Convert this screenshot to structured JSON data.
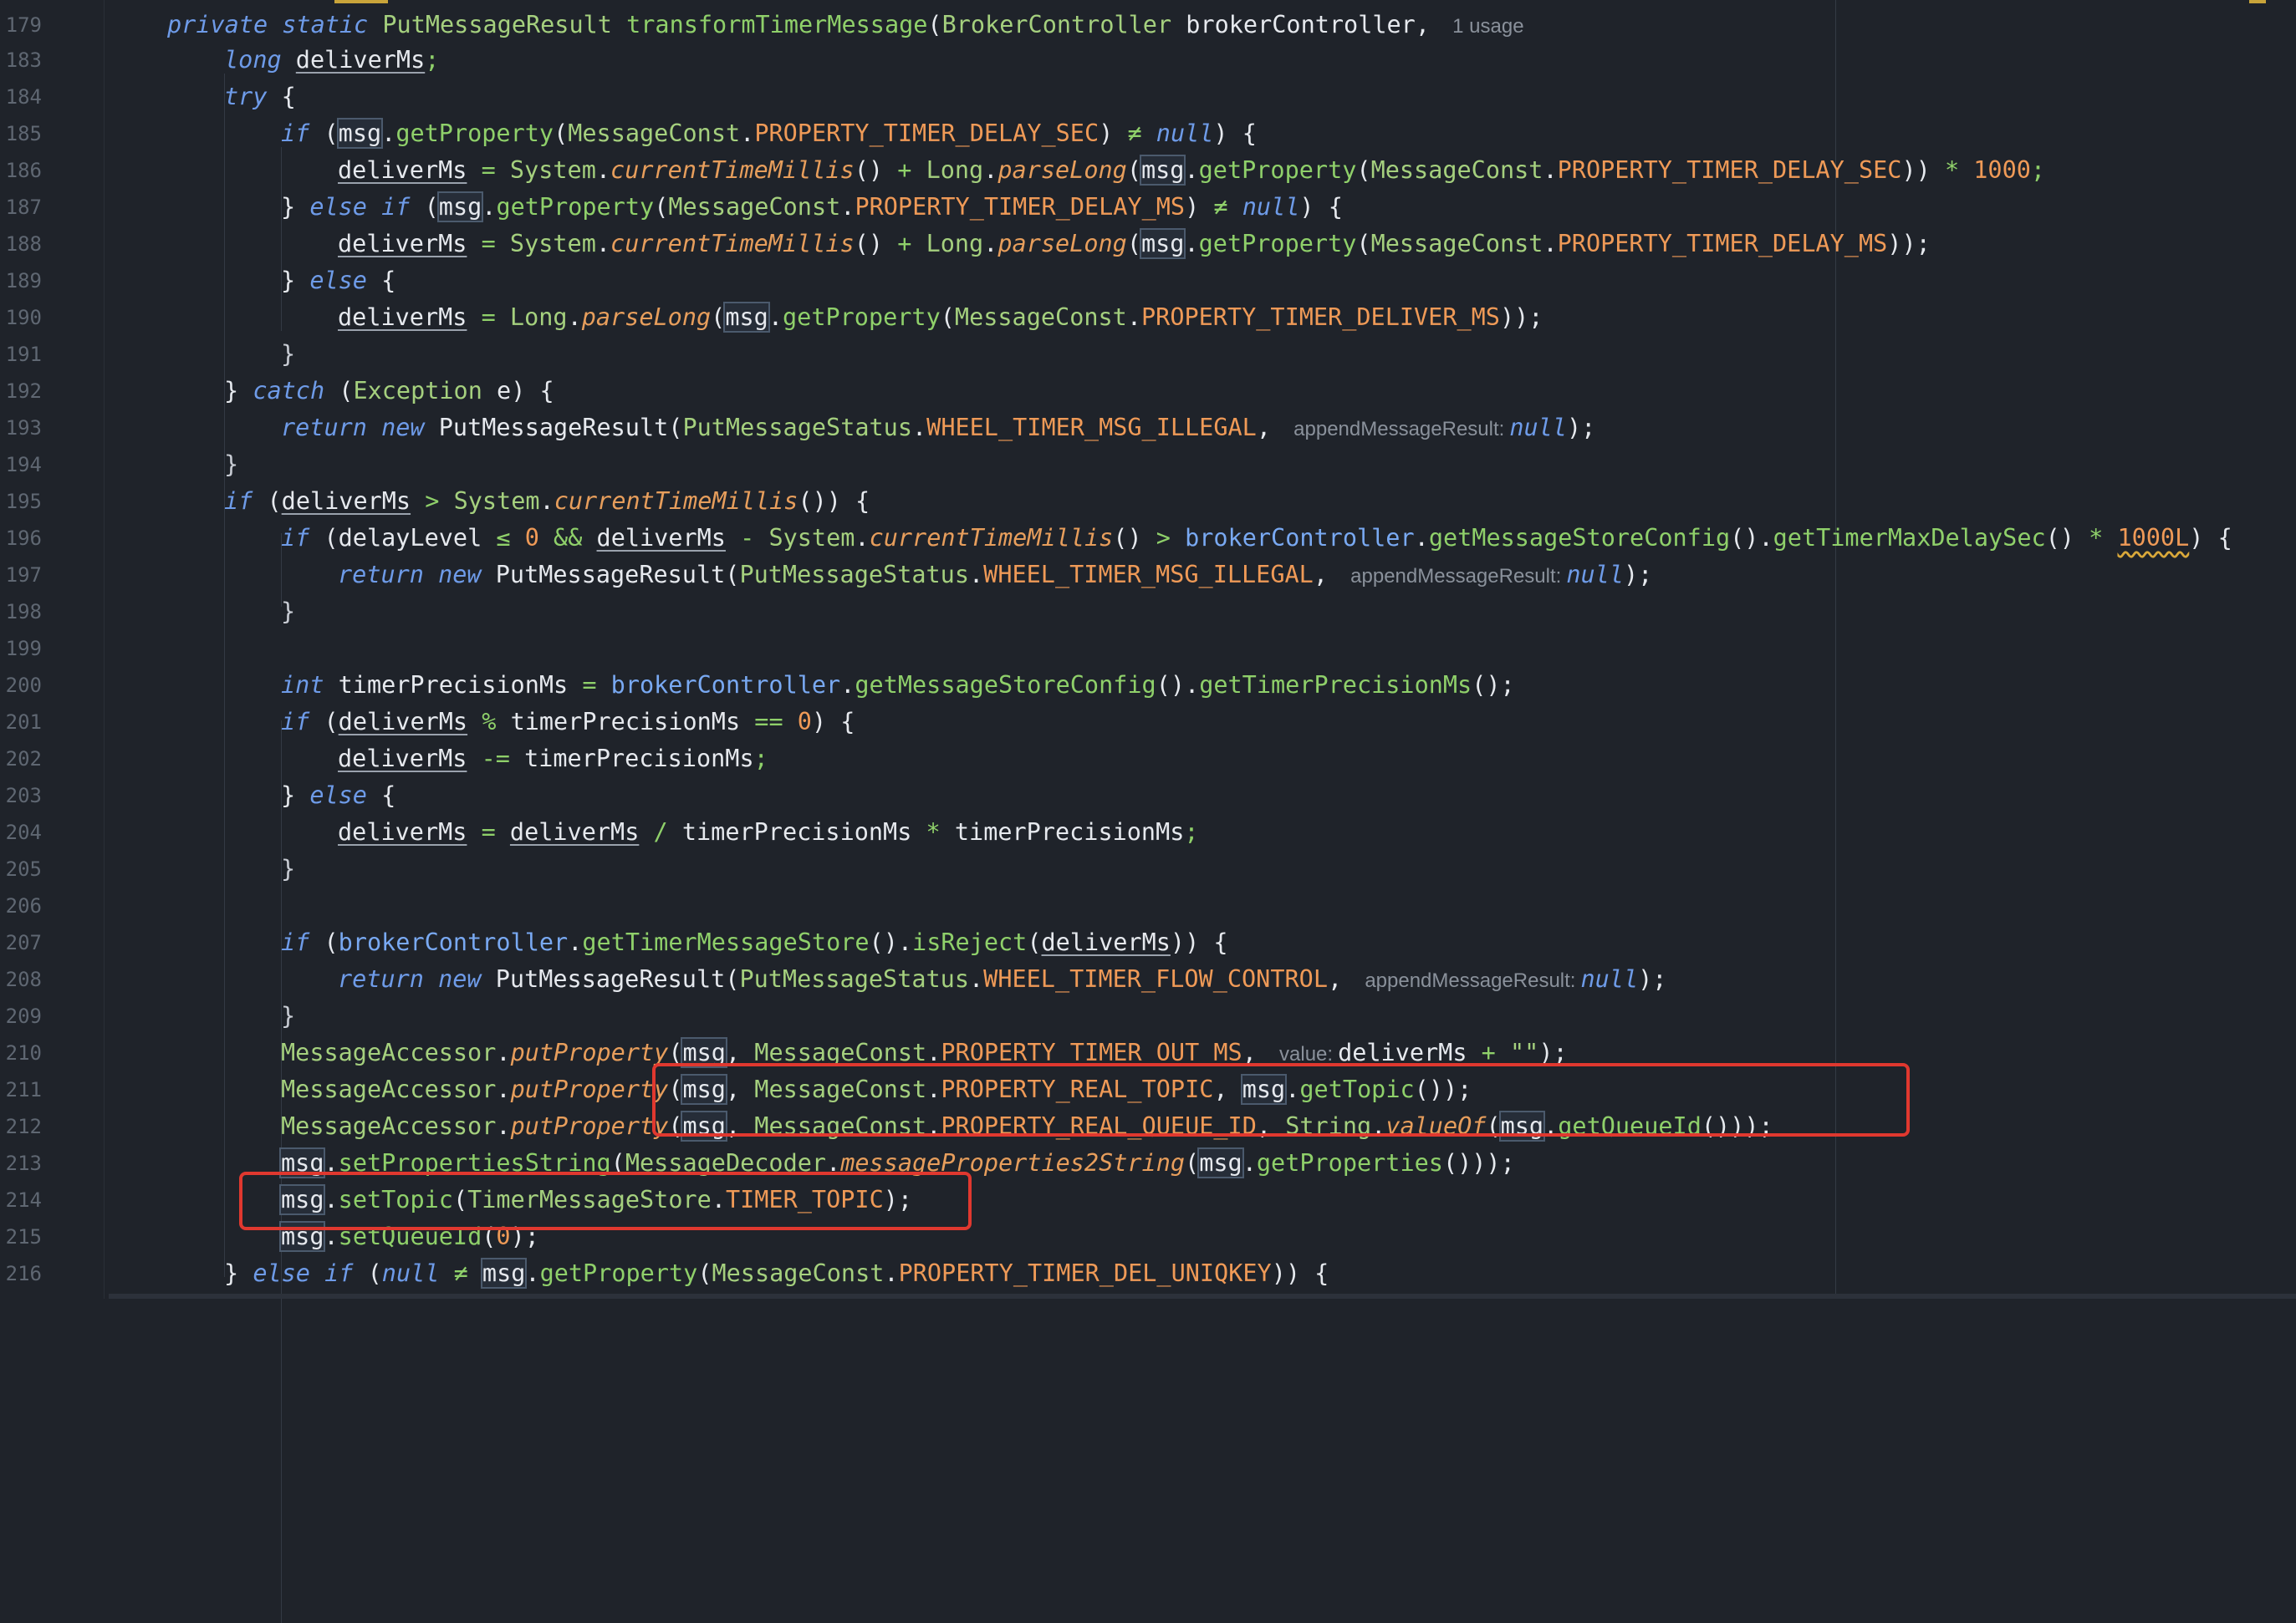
{
  "editor": {
    "usage_hint": "1 usage",
    "lines": [
      {
        "num": "179",
        "code": "private static PutMessageResult transformTimerMessage(BrokerController brokerController,"
      },
      {
        "num": "183",
        "code": "long deliverMs;"
      },
      {
        "num": "184",
        "code": "try {"
      },
      {
        "num": "185",
        "code": "if (msg.getProperty(MessageConst.PROPERTY_TIMER_DELAY_SEC) ≠ null) {"
      },
      {
        "num": "186",
        "code": "deliverMs = System.currentTimeMillis() + Long.parseLong(msg.getProperty(MessageConst.PROPERTY_TIMER_DELAY_SEC)) * 1000;"
      },
      {
        "num": "187",
        "code": "} else if (msg.getProperty(MessageConst.PROPERTY_TIMER_DELAY_MS) ≠ null) {"
      },
      {
        "num": "188",
        "code": "deliverMs = System.currentTimeMillis() + Long.parseLong(msg.getProperty(MessageConst.PROPERTY_TIMER_DELAY_MS));"
      },
      {
        "num": "189",
        "code": "} else {"
      },
      {
        "num": "190",
        "code": "deliverMs = Long.parseLong(msg.getProperty(MessageConst.PROPERTY_TIMER_DELIVER_MS));"
      },
      {
        "num": "191",
        "code": "}"
      },
      {
        "num": "192",
        "code": "} catch (Exception e) {"
      },
      {
        "num": "193",
        "code": "return new PutMessageResult(PutMessageStatus.WHEEL_TIMER_MSG_ILLEGAL, appendMessageResult: null);"
      },
      {
        "num": "194",
        "code": "}"
      },
      {
        "num": "195",
        "code": "if (deliverMs > System.currentTimeMillis()) {"
      },
      {
        "num": "196",
        "code": "if (delayLevel ≤ 0 && deliverMs - System.currentTimeMillis() > brokerController.getMessageStoreConfig().getTimerMaxDelaySec() * 1000L) {"
      },
      {
        "num": "197",
        "code": "return new PutMessageResult(PutMessageStatus.WHEEL_TIMER_MSG_ILLEGAL, appendMessageResult: null);"
      },
      {
        "num": "198",
        "code": "}"
      },
      {
        "num": "199",
        "code": ""
      },
      {
        "num": "200",
        "code": "int timerPrecisionMs = brokerController.getMessageStoreConfig().getTimerPrecisionMs();"
      },
      {
        "num": "201",
        "code": "if (deliverMs % timerPrecisionMs == 0) {"
      },
      {
        "num": "202",
        "code": "deliverMs -= timerPrecisionMs;"
      },
      {
        "num": "203",
        "code": "} else {"
      },
      {
        "num": "204",
        "code": "deliverMs = deliverMs / timerPrecisionMs * timerPrecisionMs;"
      },
      {
        "num": "205",
        "code": "}"
      },
      {
        "num": "206",
        "code": ""
      },
      {
        "num": "207",
        "code": "if (brokerController.getTimerMessageStore().isReject(deliverMs)) {"
      },
      {
        "num": "208",
        "code": "return new PutMessageResult(PutMessageStatus.WHEEL_TIMER_FLOW_CONTROL, appendMessageResult: null);"
      },
      {
        "num": "209",
        "code": "}"
      },
      {
        "num": "210",
        "code": "MessageAccessor.putProperty(msg, MessageConst.PROPERTY_TIMER_OUT_MS, value: deliverMs + \"\");"
      },
      {
        "num": "211",
        "code": "MessageAccessor.putProperty(msg, MessageConst.PROPERTY_REAL_TOPIC, msg.getTopic());"
      },
      {
        "num": "212",
        "code": "MessageAccessor.putProperty(msg, MessageConst.PROPERTY_REAL_QUEUE_ID, String.valueOf(msg.getQueueId()));"
      },
      {
        "num": "213",
        "code": "msg.setPropertiesString(MessageDecoder.messageProperties2String(msg.getProperties()));"
      },
      {
        "num": "214",
        "code": "msg.setTopic(TimerMessageStore.TIMER_TOPIC);"
      },
      {
        "num": "215",
        "code": "msg.setQueueId(0);"
      },
      {
        "num": "216",
        "code": "} else if (null ≠ msg.getProperty(MessageConst.PROPERTY_TIMER_DEL_UNIQKEY)) {"
      }
    ]
  },
  "colors": {
    "background": "#1f232a",
    "highlight_box": "#e0382f"
  }
}
